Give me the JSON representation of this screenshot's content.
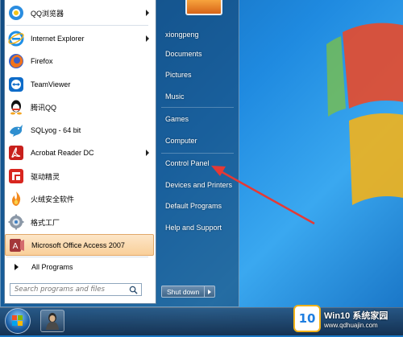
{
  "programs": [
    {
      "label": "QQ浏览器",
      "icon": "qq-browser-icon",
      "has_submenu": true
    },
    {
      "label": "Internet Explorer",
      "icon": "internet-explorer-icon",
      "has_submenu": true
    },
    {
      "label": "Firefox",
      "icon": "firefox-icon",
      "has_submenu": false
    },
    {
      "label": "TeamViewer",
      "icon": "teamviewer-icon",
      "has_submenu": false
    },
    {
      "label": "腾讯QQ",
      "icon": "tencent-qq-icon",
      "has_submenu": false
    },
    {
      "label": "SQLyog - 64 bit",
      "icon": "sqlyog-icon",
      "has_submenu": false
    },
    {
      "label": "Acrobat Reader DC",
      "icon": "acrobat-reader-icon",
      "has_submenu": true
    },
    {
      "label": "驱动精灵",
      "icon": "driver-genius-icon",
      "has_submenu": false
    },
    {
      "label": "火绒安全软件",
      "icon": "huorong-security-icon",
      "has_submenu": false
    },
    {
      "label": "格式工厂",
      "icon": "format-factory-icon",
      "has_submenu": false
    },
    {
      "label": "Microsoft Office Access 2007",
      "icon": "ms-access-icon",
      "has_submenu": false,
      "highlighted": true
    }
  ],
  "all_programs_label": "All Programs",
  "search": {
    "placeholder": "Search programs and files",
    "value": ""
  },
  "right_pane": {
    "user": "xiongpeng",
    "documents": "Documents",
    "pictures": "Pictures",
    "music": "Music",
    "games": "Games",
    "computer": "Computer",
    "control_panel": "Control Panel",
    "devices": "Devices and Printers",
    "default_programs": "Default Programs",
    "help": "Help and Support"
  },
  "shutdown_label": "Shut down",
  "watermark": {
    "badge": "10",
    "title": "Win10 系统家园",
    "url": "www.qdhuajin.com"
  },
  "colors": {
    "highlight": "#f9cf99",
    "annotation_arrow": "#e53935",
    "accent": "#1f7ee0"
  }
}
